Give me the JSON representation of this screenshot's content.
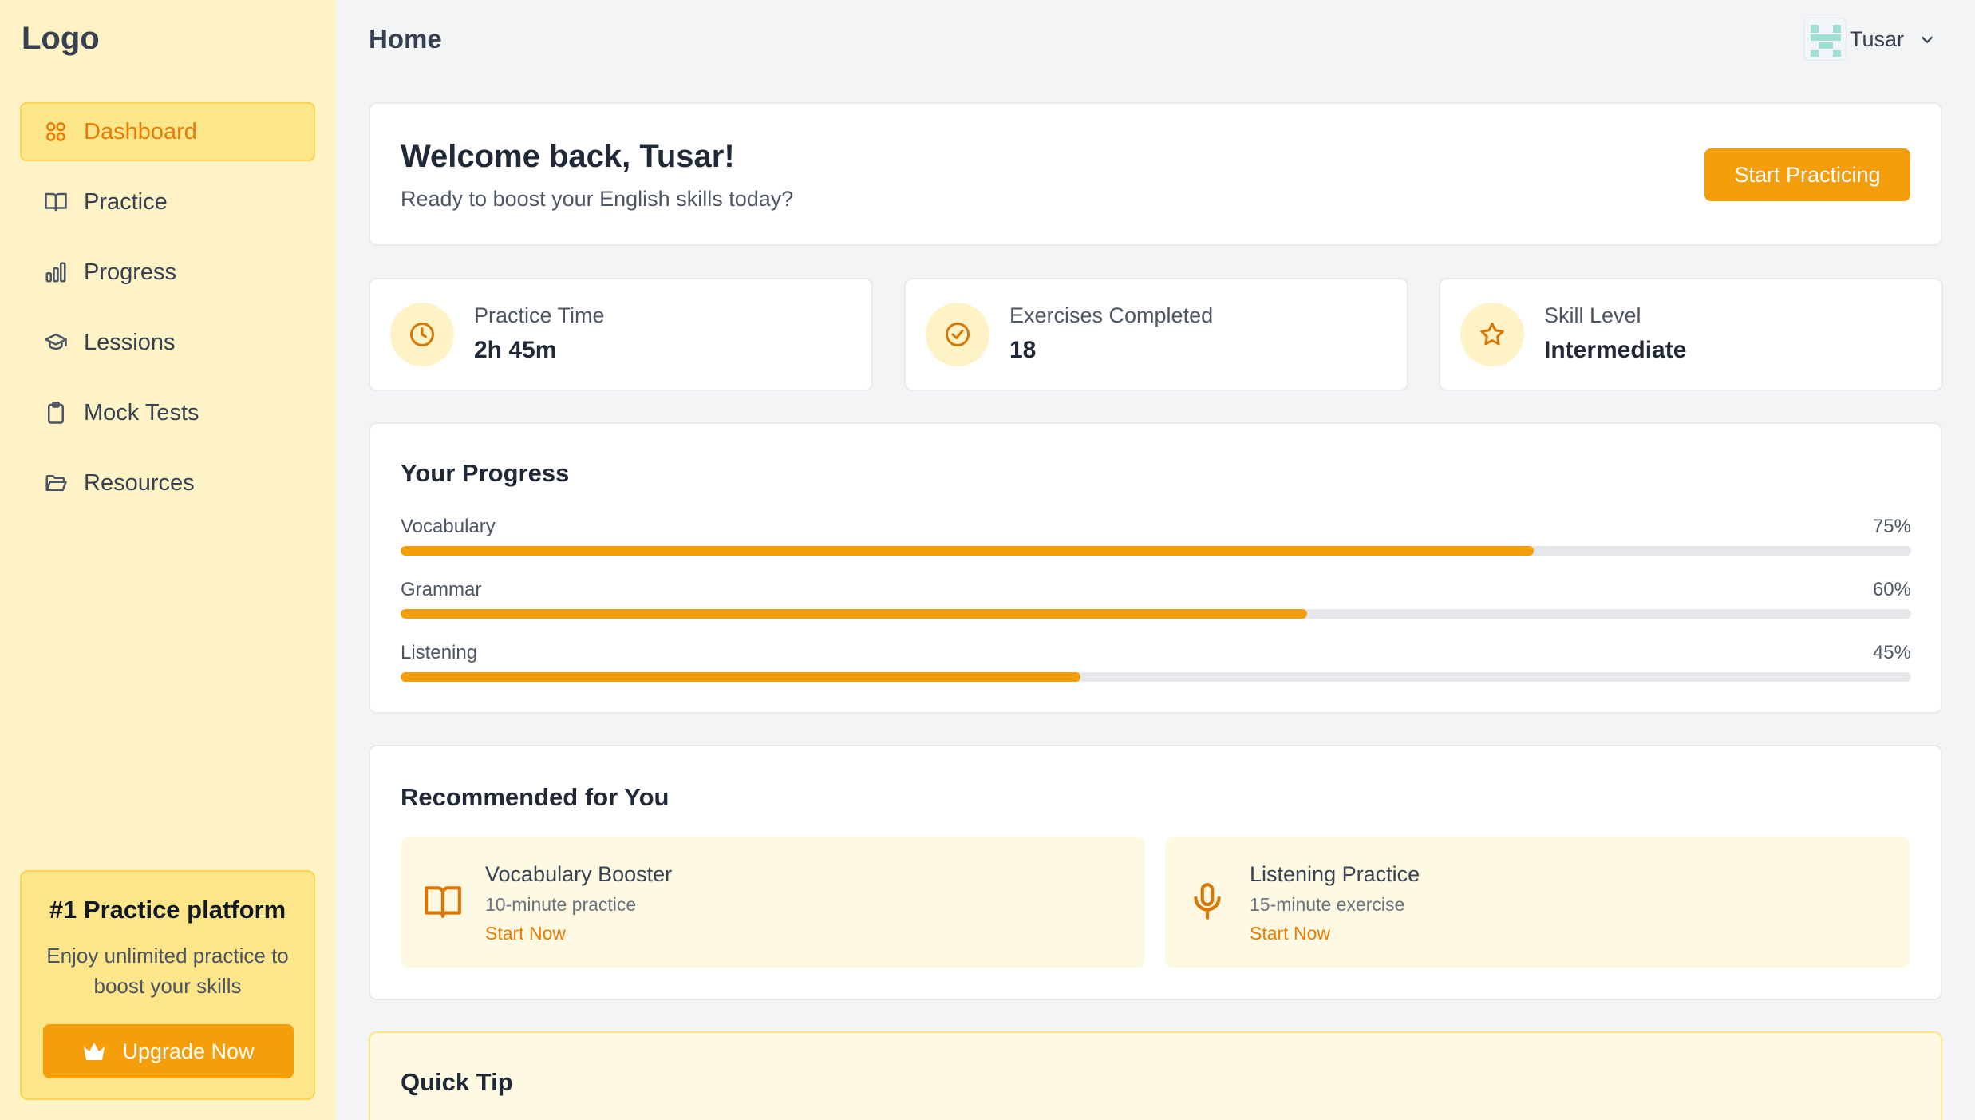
{
  "logo": "Logo",
  "nav": [
    {
      "label": "Dashboard",
      "icon": "dashboard-icon",
      "active": true
    },
    {
      "label": "Practice",
      "icon": "book-icon"
    },
    {
      "label": "Progress",
      "icon": "bar-chart-icon"
    },
    {
      "label": "Lessions",
      "icon": "graduation-cap-icon"
    },
    {
      "label": "Mock Tests",
      "icon": "clipboard-icon"
    },
    {
      "label": "Resources",
      "icon": "folder-icon"
    }
  ],
  "promo": {
    "title": "#1 Practice platform",
    "text": "Enjoy unlimited practice to boost your skills",
    "button": "Upgrade Now"
  },
  "header": {
    "title": "Home",
    "user": "Tusar"
  },
  "welcome": {
    "title": "Welcome back, Tusar!",
    "subtitle": "Ready to boost your English skills today?",
    "button": "Start Practicing"
  },
  "stats": [
    {
      "label": "Practice Time",
      "value": "2h 45m",
      "icon": "clock-icon"
    },
    {
      "label": "Exercises Completed",
      "value": "18",
      "icon": "check-circle-icon"
    },
    {
      "label": "Skill Level",
      "value": "Intermediate",
      "icon": "star-icon"
    }
  ],
  "progress": {
    "title": "Your Progress",
    "items": [
      {
        "label": "Vocabulary",
        "value": "75%",
        "fraction": 0.75
      },
      {
        "label": "Grammar",
        "value": "60%",
        "fraction": 0.6
      },
      {
        "label": "Listening",
        "value": "45%",
        "fraction": 0.45
      }
    ]
  },
  "recommended": {
    "title": "Recommended for You",
    "items": [
      {
        "title": "Vocabulary Booster",
        "subtitle": "10-minute practice",
        "link": "Start Now",
        "icon": "book-open-icon"
      },
      {
        "title": "Listening Practice",
        "subtitle": "15-minute exercise",
        "link": "Start Now",
        "icon": "microphone-icon"
      }
    ]
  },
  "tip": {
    "title": "Quick Tip"
  },
  "colors": {
    "accent": "#f59e0b",
    "sidebar": "#fdf3c7",
    "active_text": "#ea7c05"
  }
}
